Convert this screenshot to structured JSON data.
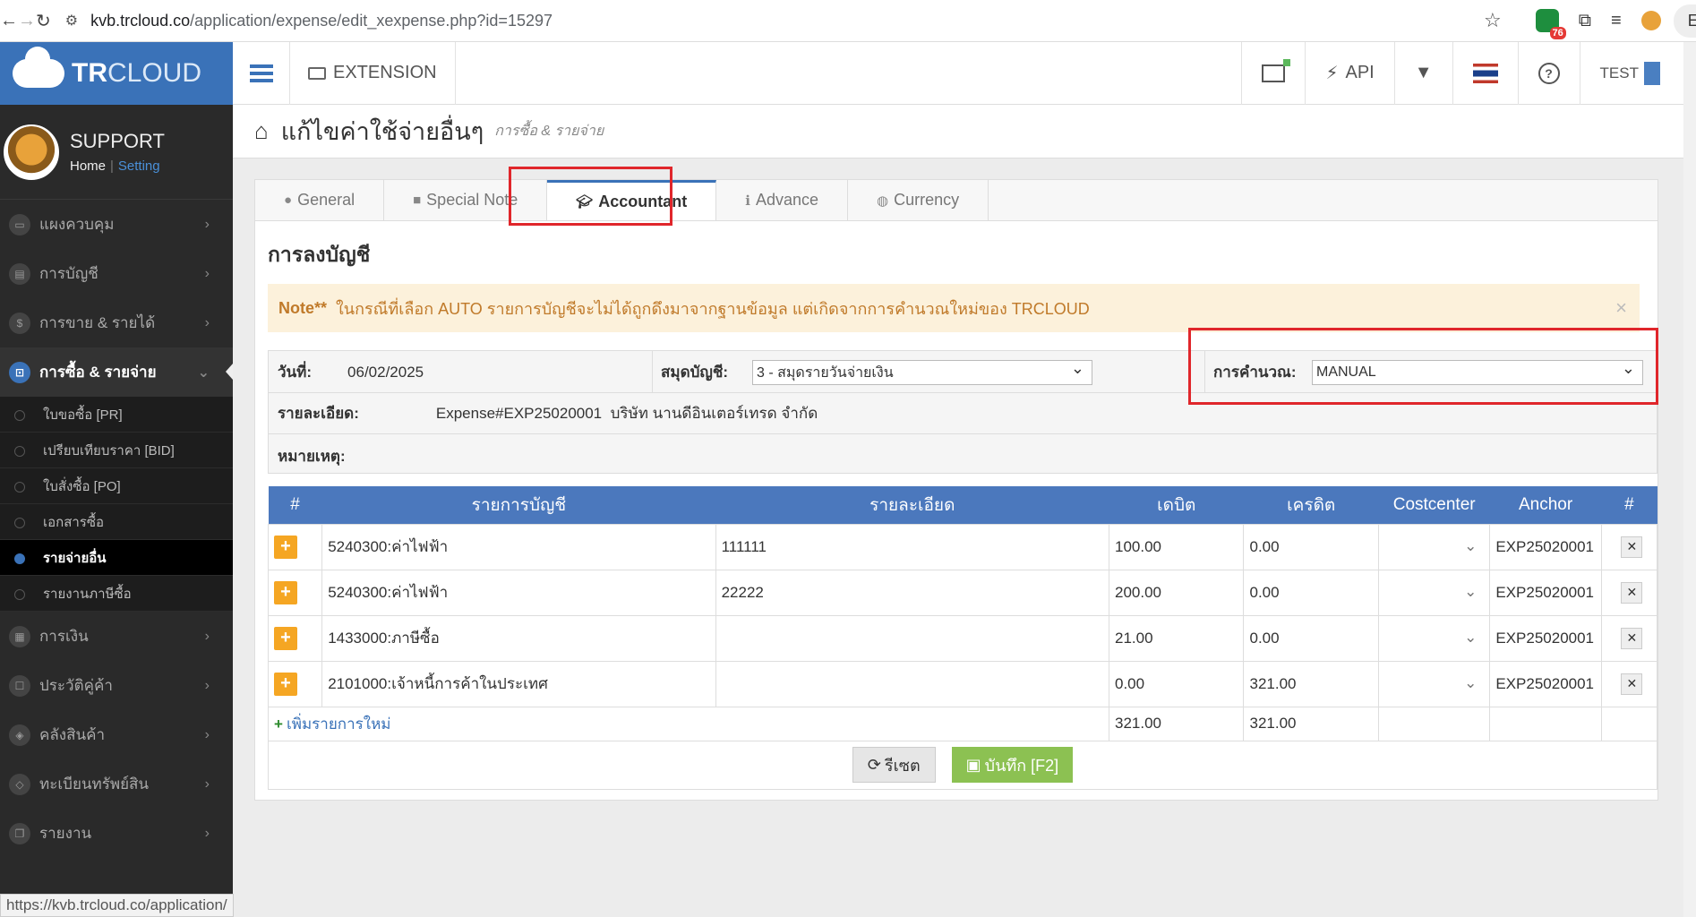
{
  "browser": {
    "url_host": "kvb.trcloud.co",
    "url_path": "/application/expense/edit_xexpense.php?id=15297",
    "ext_badge": "76",
    "error_label": "Error"
  },
  "sidebar": {
    "logo_tr": "TR",
    "logo_cloud": "CLOUD",
    "user_name": "SUPPORT",
    "home_link": "Home",
    "setting_link": "Setting",
    "menu": [
      {
        "label": "แผงควบคุม"
      },
      {
        "label": "การบัญชี"
      },
      {
        "label": "การขาย & รายได้"
      },
      {
        "label": "การซื้อ & รายจ่าย"
      },
      {
        "label": "การเงิน"
      },
      {
        "label": "ประวัติคู่ค้า"
      },
      {
        "label": "คลังสินค้า"
      },
      {
        "label": "ทะเบียนทรัพย์สิน"
      },
      {
        "label": "รายงาน"
      }
    ],
    "submenu": [
      {
        "label": "ใบขอซื้อ [PR]"
      },
      {
        "label": "เปรียบเทียบราคา [BID]"
      },
      {
        "label": "ใบสั่งซื้อ [PO]"
      },
      {
        "label": "เอกสารซื้อ"
      },
      {
        "label": "รายจ่ายอื่น"
      },
      {
        "label": "รายงานภาษีซื้อ"
      }
    ],
    "status_url": "https://kvb.trcloud.co/application/"
  },
  "header": {
    "extension": "EXTENSION",
    "api": "API",
    "test": "TEST"
  },
  "page": {
    "title": "แก้ไขค่าใช้จ่ายอื่นๆ",
    "subtitle": "การซื้อ & รายจ่าย"
  },
  "tabs": [
    {
      "label": "General"
    },
    {
      "label": "Special Note"
    },
    {
      "label": "Accountant"
    },
    {
      "label": "Advance"
    },
    {
      "label": "Currency"
    }
  ],
  "section_title": "การลงบัญชี",
  "alert": {
    "strong": "Note**",
    "text": "ในกรณีที่เลือก AUTO รายการบัญชีจะไม่ได้ถูกดึงมาจากฐานข้อมูล แต่เกิดจากการคำนวณใหม่ของ TRCLOUD",
    "close": "×"
  },
  "info": {
    "date_label": "วันที่:",
    "date_value": "06/02/2025",
    "journal_label": "สมุดบัญชี:",
    "journal_value": "3 - สมุดรายวันจ่ายเงิน",
    "calc_label": "การคำนวณ:",
    "calc_value": "MANUAL",
    "detail_label": "รายละเอียด:",
    "detail_value": "Expense#EXP25020001  บริษัท นานดีอินเตอร์เทรด จำกัด",
    "remark_label": "หมายเหตุ:"
  },
  "table": {
    "headers": [
      "#",
      "รายการบัญชี",
      "รายละเอียด",
      "เดบิต",
      "เครดิต",
      "Costcenter",
      "Anchor",
      "#"
    ],
    "rows": [
      {
        "account": "5240300:ค่าไฟฟ้า",
        "detail": "111111",
        "debit": "100.00",
        "credit": "0.00",
        "anchor": "EXP25020001"
      },
      {
        "account": "5240300:ค่าไฟฟ้า",
        "detail": "22222",
        "debit": "200.00",
        "credit": "0.00",
        "anchor": "EXP25020001"
      },
      {
        "account": "1433000:ภาษีซื้อ",
        "detail": "",
        "debit": "21.00",
        "credit": "0.00",
        "anchor": "EXP25020001"
      },
      {
        "account": "2101000:เจ้าหนี้การค้าในประเทศ",
        "detail": "",
        "debit": "0.00",
        "credit": "321.00",
        "anchor": "EXP25020001"
      }
    ],
    "add_label": "เพิ่มรายการใหม่",
    "total_debit": "321.00",
    "total_credit": "321.00"
  },
  "buttons": {
    "reset": "รีเซต",
    "save": "บันทึก [F2]"
  }
}
